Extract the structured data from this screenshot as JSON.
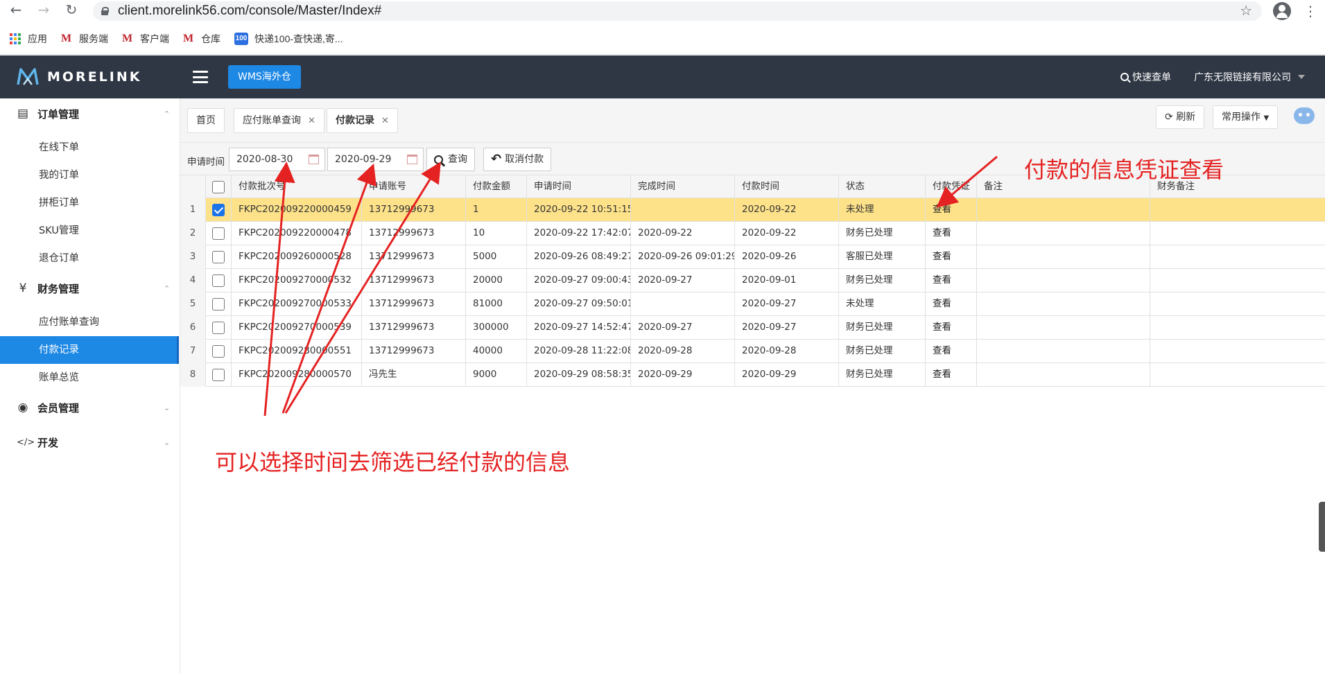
{
  "browser": {
    "url": "client.morelink56.com/console/Master/Index#",
    "bookmarks": [
      "应用",
      "服务端",
      "客户端",
      "仓库",
      "快递100-查快递,寄..."
    ]
  },
  "header": {
    "brand": "MORELINK",
    "wms_button": "WMS海外仓",
    "quick_lookup": "快速查单",
    "company": "广东无限链接有限公司"
  },
  "sidebar": {
    "groups": [
      {
        "label": "订单管理",
        "icon": "order-icon",
        "items": [
          "在线下单",
          "我的订单",
          "拼柜订单",
          "SKU管理",
          "退仓订单"
        ]
      },
      {
        "label": "财务管理",
        "icon": "yen-icon",
        "items": [
          "应付账单查询",
          "付款记录",
          "账单总览"
        ]
      },
      {
        "label": "会员管理",
        "icon": "user-icon",
        "items": []
      },
      {
        "label": "开发",
        "icon": "code-icon",
        "items": []
      }
    ],
    "active_item": "付款记录"
  },
  "tabs": [
    {
      "label": "首页",
      "closable": false
    },
    {
      "label": "应付账单查询",
      "closable": true
    },
    {
      "label": "付款记录",
      "closable": true
    }
  ],
  "toolbar": {
    "refresh": "刷新",
    "common_ops": "常用操作"
  },
  "filter": {
    "label": "申请时间",
    "date_from": "2020-08-30",
    "date_to": "2020-09-29",
    "query_button": "查询",
    "cancel_button": "取消付款"
  },
  "table": {
    "columns": [
      "付款批次号",
      "申请账号",
      "付款金额",
      "申请时间",
      "完成时间",
      "付款时间",
      "状态",
      "付款凭证",
      "备注",
      "财务备注"
    ],
    "rows": [
      {
        "n": "1",
        "checked": true,
        "batch": "FKPC202009220000459",
        "account": "13712999673",
        "amount": "1",
        "apply": "2020-09-22 10:51:15",
        "done": "",
        "paid": "2020-09-22",
        "status": "未处理",
        "voucher": "查看",
        "note": "",
        "fin_note": ""
      },
      {
        "n": "2",
        "checked": false,
        "batch": "FKPC202009220000478",
        "account": "13712999673",
        "amount": "10",
        "apply": "2020-09-22 17:42:07",
        "done": "2020-09-22",
        "paid": "2020-09-22",
        "status": "财务已处理",
        "voucher": "查看",
        "note": "",
        "fin_note": ""
      },
      {
        "n": "3",
        "checked": false,
        "batch": "FKPC202009260000528",
        "account": "13712999673",
        "amount": "5000",
        "apply": "2020-09-26 08:49:27",
        "done": "2020-09-26 09:01:29",
        "paid": "2020-09-26",
        "status": "客服已处理",
        "voucher": "查看",
        "note": "",
        "fin_note": ""
      },
      {
        "n": "4",
        "checked": false,
        "batch": "FKPC202009270000532",
        "account": "13712999673",
        "amount": "20000",
        "apply": "2020-09-27 09:00:43",
        "done": "2020-09-27",
        "paid": "2020-09-01",
        "status": "财务已处理",
        "voucher": "查看",
        "note": "",
        "fin_note": ""
      },
      {
        "n": "5",
        "checked": false,
        "batch": "FKPC202009270000533",
        "account": "13712999673",
        "amount": "81000",
        "apply": "2020-09-27 09:50:01",
        "done": "",
        "paid": "2020-09-27",
        "status": "未处理",
        "voucher": "查看",
        "note": "",
        "fin_note": ""
      },
      {
        "n": "6",
        "checked": false,
        "batch": "FKPC202009270000539",
        "account": "13712999673",
        "amount": "300000",
        "apply": "2020-09-27 14:52:47",
        "done": "2020-09-27",
        "paid": "2020-09-27",
        "status": "财务已处理",
        "voucher": "查看",
        "note": "",
        "fin_note": ""
      },
      {
        "n": "7",
        "checked": false,
        "batch": "FKPC202009280000551",
        "account": "13712999673",
        "amount": "40000",
        "apply": "2020-09-28 11:22:08",
        "done": "2020-09-28",
        "paid": "2020-09-28",
        "status": "财务已处理",
        "voucher": "查看",
        "note": "",
        "fin_note": ""
      },
      {
        "n": "8",
        "checked": false,
        "batch": "FKPC202009280000570",
        "account": "冯先生",
        "amount": "9000",
        "apply": "2020-09-29 08:58:35",
        "done": "2020-09-29",
        "paid": "2020-09-29",
        "status": "财务已处理",
        "voucher": "查看",
        "note": "",
        "fin_note": ""
      }
    ]
  },
  "annotations": {
    "voucher_note": "付款的信息凭证查看",
    "filter_note": "可以选择时间去筛选已经付款的信息",
    "color": "#e52222"
  },
  "colors": {
    "header_bg": "#2f3744",
    "accent": "#1e88e5",
    "selected_row": "#fde28a"
  }
}
